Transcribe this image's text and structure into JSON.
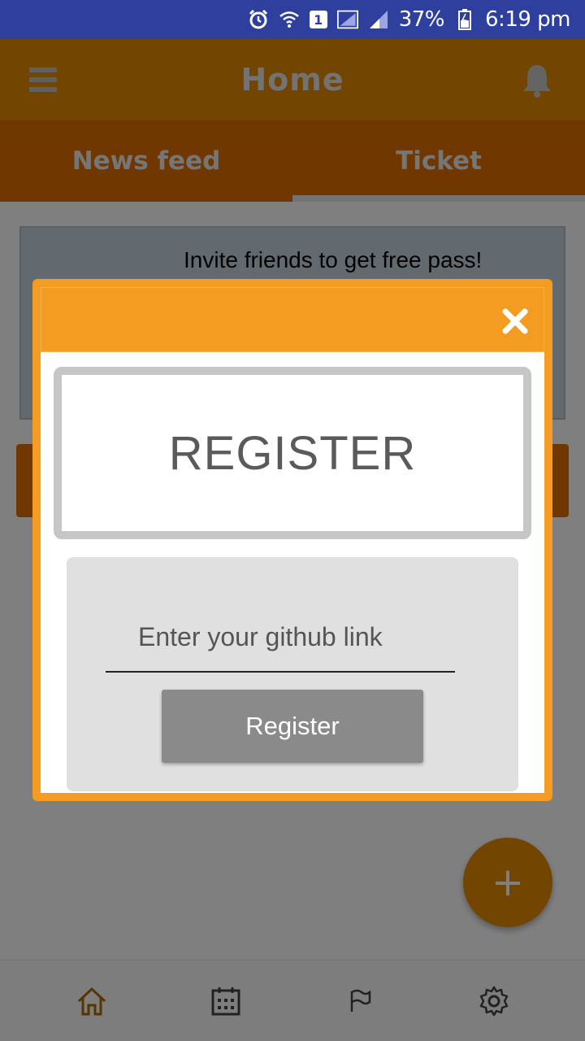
{
  "status_bar": {
    "battery": "37%",
    "time": "6:19 pm",
    "sim_slot": "1",
    "icons": [
      "alarm-icon",
      "wifi-icon",
      "sim-icon",
      "signal-icon",
      "signal-icon",
      "battery-icon"
    ]
  },
  "app_bar": {
    "title": "Home",
    "menu_icon": "menu-icon",
    "notification_icon": "bell-icon"
  },
  "tabs": [
    {
      "label": "News feed",
      "active": false
    },
    {
      "label": "Ticket",
      "active": true
    }
  ],
  "content": {
    "invite_text": "Invite friends to get free pass!",
    "fab_label": "+"
  },
  "dialog": {
    "close_icon": "close-icon",
    "heading": "REGISTER",
    "input_placeholder": "Enter your github link",
    "input_value": "",
    "button_label": "Register"
  },
  "bottom_nav": [
    {
      "icon": "home-icon",
      "active": true
    },
    {
      "icon": "calendar-icon",
      "active": false
    },
    {
      "icon": "flag-icon",
      "active": false
    },
    {
      "icon": "gear-icon",
      "active": false
    }
  ],
  "colors": {
    "status_bar": "#2f3f9e",
    "app_bar": "#e58a00",
    "tabs": "#e07000",
    "dialog_accent": "#f39c21",
    "active_nav": "#b06a00"
  }
}
